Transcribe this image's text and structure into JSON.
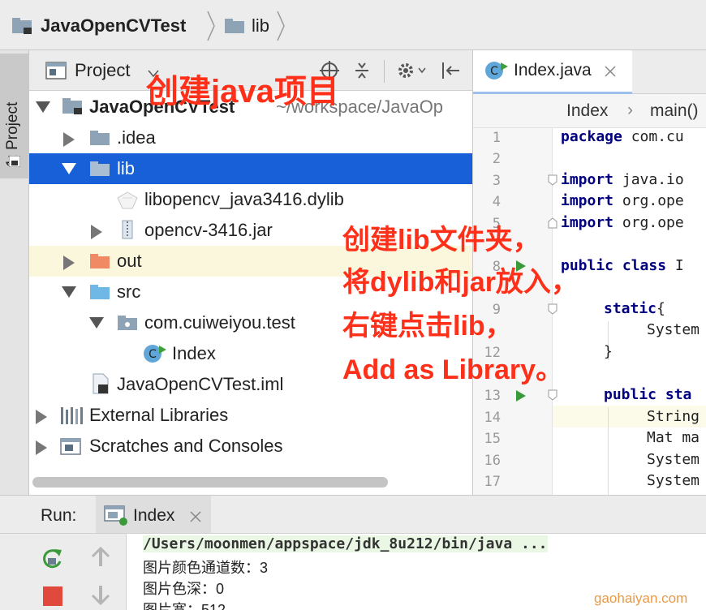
{
  "breadcrumb": {
    "project": "JavaOpenCVTest",
    "folder": "lib"
  },
  "side_stripe": {
    "project_tab": "1: Project"
  },
  "project_panel": {
    "title": "Project",
    "tree": [
      {
        "label": "JavaOpenCVTest",
        "path": "~/workspace/JavaOp"
      },
      {
        "label": ".idea"
      },
      {
        "label": "lib"
      },
      {
        "label": "libopencv_java3416.dylib"
      },
      {
        "label": "opencv-3416.jar"
      },
      {
        "label": "out"
      },
      {
        "label": "src"
      },
      {
        "label": "com.cuiweiyou.test"
      },
      {
        "label": "Index"
      },
      {
        "label": "JavaOpenCVTest.iml"
      },
      {
        "label": "External Libraries"
      },
      {
        "label": "Scratches and Consoles"
      }
    ]
  },
  "editor": {
    "tab_label": "Index.java",
    "breadcrumb_class": "Index",
    "breadcrumb_sep": "›",
    "breadcrumb_method": "main()",
    "line_numbers": [
      "1",
      "2",
      "3",
      "4",
      "5",
      "8",
      "9",
      "12",
      "13",
      "14",
      "15",
      "16",
      "17"
    ],
    "code": {
      "l1_kw": "package",
      "l1_rest": " com.cu",
      "l3_kw": "import",
      "l3_rest": " java.io",
      "l4_kw": "import",
      "l4_rest": " org.ope",
      "l5_kw": "import",
      "l5_rest": " org.ope",
      "l8_kw": "public class",
      "l8_rest": " I",
      "l9_kw": "static",
      "l9_rest": "{",
      "l10": "System",
      "l12": "}",
      "l13_kw": "public sta",
      "l14": "String",
      "l15": "Mat ma",
      "l16": "System",
      "l17": "System"
    }
  },
  "run_panel": {
    "label": "Run:",
    "tab": "Index",
    "console_lines": [
      "/Users/moonmen/appspace/jdk_8u212/bin/java ...",
      "图片颜色通道数：3",
      "图片色深：0",
      "图片宽：512"
    ]
  },
  "annotations": {
    "create_project": "创建java项目",
    "instructions": [
      "创建lib文件夹，",
      "将dylib和jar放入，",
      "右键点击lib，",
      "Add as Library。"
    ]
  },
  "watermark": "gaohaiyan.com",
  "colors": {
    "selection": "#1760d7",
    "annotation": "#ff3019",
    "keyword": "#000080",
    "run_green": "#3a9a3a",
    "stop_red": "#e0493b"
  }
}
